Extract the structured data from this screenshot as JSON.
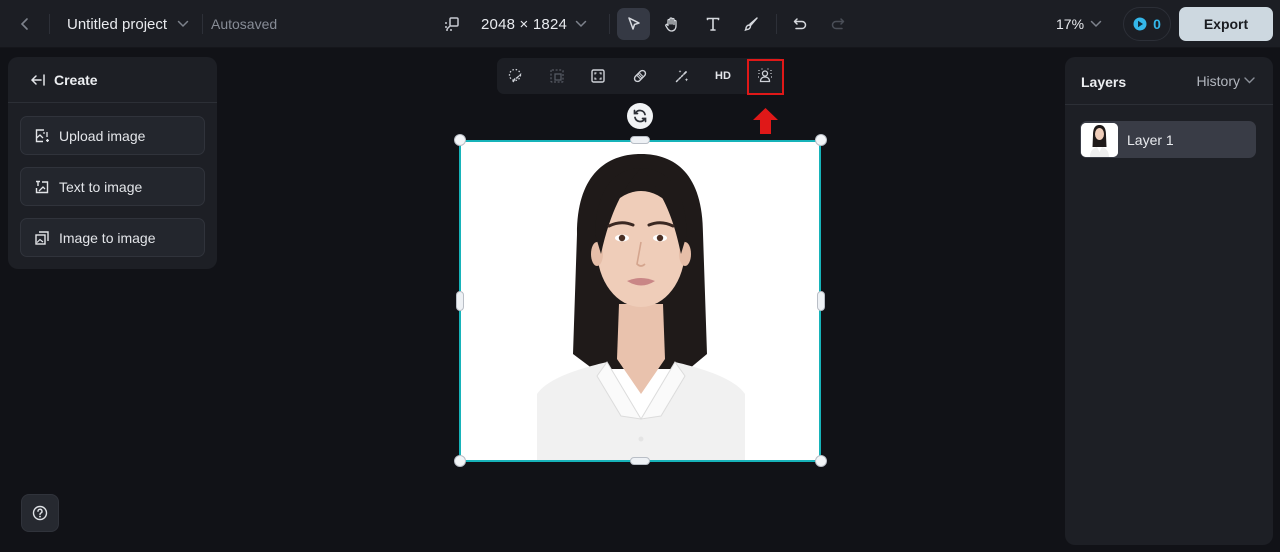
{
  "topbar": {
    "project_title": "Untitled project",
    "save_status": "Autosaved",
    "canvas_size": "2048 × 1824",
    "tools": [
      {
        "name": "select-tool",
        "icon": "pointer-arrow-icon",
        "active": true
      },
      {
        "name": "hand-tool",
        "icon": "hand-icon",
        "active": false
      },
      {
        "name": "text-tool",
        "icon": "text-T-icon",
        "active": false
      },
      {
        "name": "brush-tool",
        "icon": "paintbrush-icon",
        "active": false
      }
    ],
    "undo_icon": "undo-icon",
    "redo_icon": "redo-icon",
    "zoom_level": "17%",
    "credits": "0",
    "export_label": "Export"
  },
  "left_panel": {
    "header": "Create",
    "items": [
      {
        "label": "Upload image",
        "icon": "upload-image-icon"
      },
      {
        "label": "Text to image",
        "icon": "text-to-image-icon"
      },
      {
        "label": "Image to image",
        "icon": "image-to-image-icon"
      }
    ]
  },
  "float_toolbar": {
    "items": [
      {
        "name": "inpaint",
        "icon": "lasso-brush-icon",
        "disabled": false
      },
      {
        "name": "expand",
        "icon": "expand-frame-icon",
        "disabled": true
      },
      {
        "name": "crop",
        "icon": "crop-frame-icon",
        "disabled": false
      },
      {
        "name": "eraser",
        "icon": "eraser-bandage-icon",
        "disabled": false
      },
      {
        "name": "magic-wand",
        "icon": "magic-wand-icon",
        "disabled": false
      },
      {
        "name": "upscale",
        "label": "HD",
        "disabled": false
      },
      {
        "name": "remove-background",
        "icon": "person-background-icon",
        "disabled": false,
        "highlighted": true
      }
    ],
    "highlight_color": "#e01818"
  },
  "canvas": {
    "selection_color": "#17b3b9",
    "image_subject": "portrait of woman in white shirt"
  },
  "right_panel": {
    "title": "Layers",
    "history_label": "History",
    "layers": [
      {
        "name": "Layer 1",
        "selected": true
      }
    ]
  }
}
